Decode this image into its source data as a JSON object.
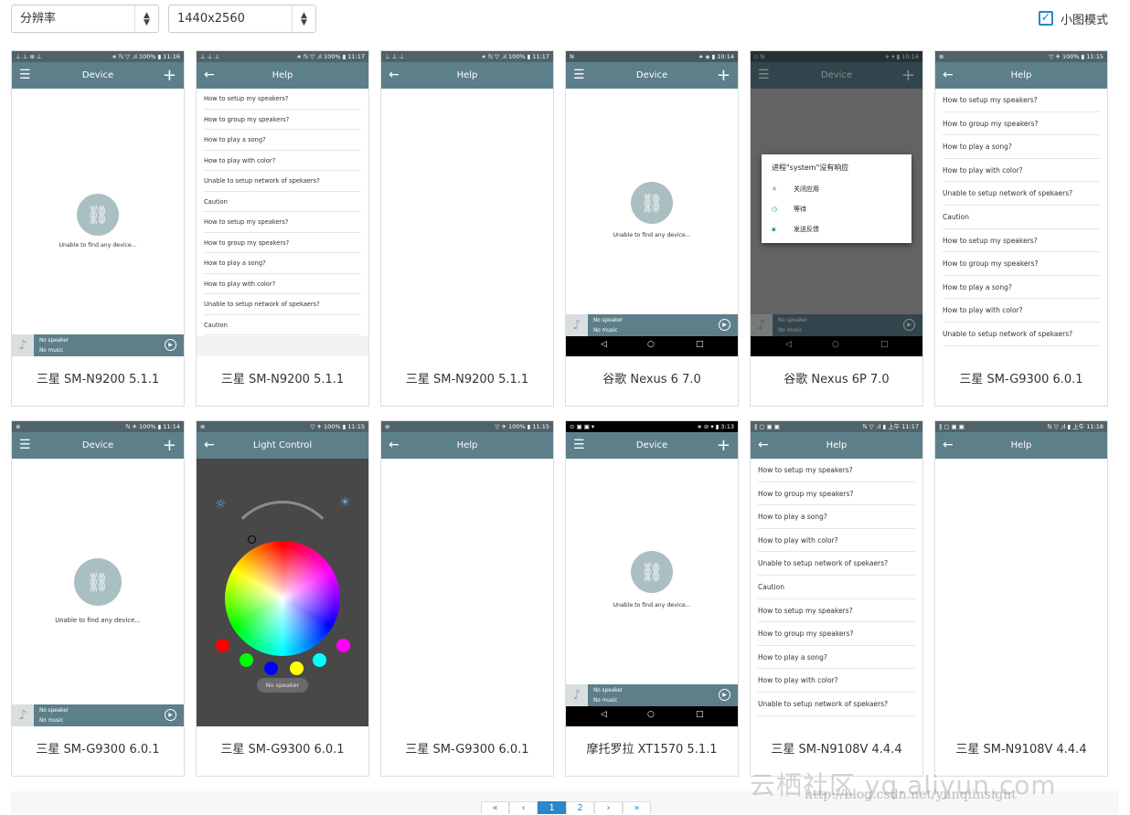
{
  "toolbar": {
    "resolution_select": "分辨率",
    "size_select": "1440x2560",
    "small_mode_label": "小图模式",
    "small_mode_checked": true
  },
  "help_items": [
    "How to setup my speakers?",
    "How to group my speakers?",
    "How to play a song?",
    "How to play with color?",
    "Unable to setup network of spekaers?",
    "Caution",
    "How to setup my speakers?",
    "How to group my speakers?",
    "How to play a song?",
    "How to play with color?",
    "Unable to setup network of spekaers?",
    "Caution"
  ],
  "cards": [
    {
      "caption": "三星 SM-N9200 5.1.1",
      "title": "Device",
      "status_left": "⊥ ⊥ ⊛ ⊥",
      "status_right": "∗ ℕ ▽ .ıl 100% ▮ 11:16"
    },
    {
      "caption": "三星 SM-N9200 5.1.1",
      "title": "Help",
      "status_left": "⊥ ⊥ ⊥",
      "status_right": "∗ ℕ ▽ .ıl 100% ▮ 11:17"
    },
    {
      "caption": "三星 SM-N9200 5.1.1",
      "title": "Help",
      "status_left": "⊥ ⊥ ⊥",
      "status_right": "∗ ℕ ▽ .ıl 100% ▮ 11:17"
    },
    {
      "caption": "谷歌 Nexus 6 7.0",
      "title": "Device",
      "status_left": "N",
      "status_right": "∗ ◈ ▮ 10:14"
    },
    {
      "caption": "谷歌 Nexus 6P 7.0",
      "title": "Device",
      "status_left": "▫ N",
      "status_right": "∗ ▾ ▮ 10:14"
    },
    {
      "caption": "三星 SM-G9300 6.0.1",
      "title": "Help",
      "status_left": "⊛",
      "status_right": "▽ ✈ 100% ▮ 11:15"
    },
    {
      "caption": "三星 SM-G9300 6.0.1",
      "title": "Device",
      "status_left": "⊛",
      "status_right": "ℕ ✈ 100% ▮ 11:14"
    },
    {
      "caption": "三星 SM-G9300 6.0.1",
      "title": "Light Control",
      "status_left": "⊛",
      "status_right": "▽ ✈ 100% ▮ 11:15"
    },
    {
      "caption": "三星 SM-G9300 6.0.1",
      "title": "Help",
      "status_left": "⊛",
      "status_right": "▽ ✈ 100% ▮ 11:15"
    },
    {
      "caption": "摩托罗拉 XT1570 5.1.1",
      "title": "Device",
      "status_left": "⊙ ▣ ▣ ▾",
      "status_right": "∗ ⊘ ▾ ▮ 3:13"
    },
    {
      "caption": "三星 SM-N9108V 4.4.4",
      "title": "Help",
      "status_left": "‖ ▢ ▣ ▣",
      "status_right": "ℕ ▽ .ıl ▮ 上午 11:17"
    },
    {
      "caption": "三星 SM-N9108V 4.4.4",
      "title": "Help",
      "status_left": "‖ ▢ ▣ ▣",
      "status_right": "ℕ ▽ .ıl ▮ 上午 11:18"
    }
  ],
  "empty_state": {
    "message": "Unable to find any device...",
    "speaker": "No speaker",
    "music": "No music"
  },
  "dialog": {
    "title": "进程\"system\"没有响应",
    "close": "关闭应用",
    "wait": "等待",
    "feedback": "发送反馈"
  },
  "light_control": {
    "pill": "No speaker",
    "colors": [
      "#ff0000",
      "#00ff00",
      "#0000ff",
      "#ffff00",
      "#00ffff",
      "#ff00ff"
    ]
  },
  "pagination": {
    "pages": [
      "1",
      "2"
    ],
    "current": "1"
  },
  "watermark": {
    "brand": "云栖社区 yq.aliyun.com",
    "url": "http://blog.csdn.net/yunqiinsight"
  }
}
